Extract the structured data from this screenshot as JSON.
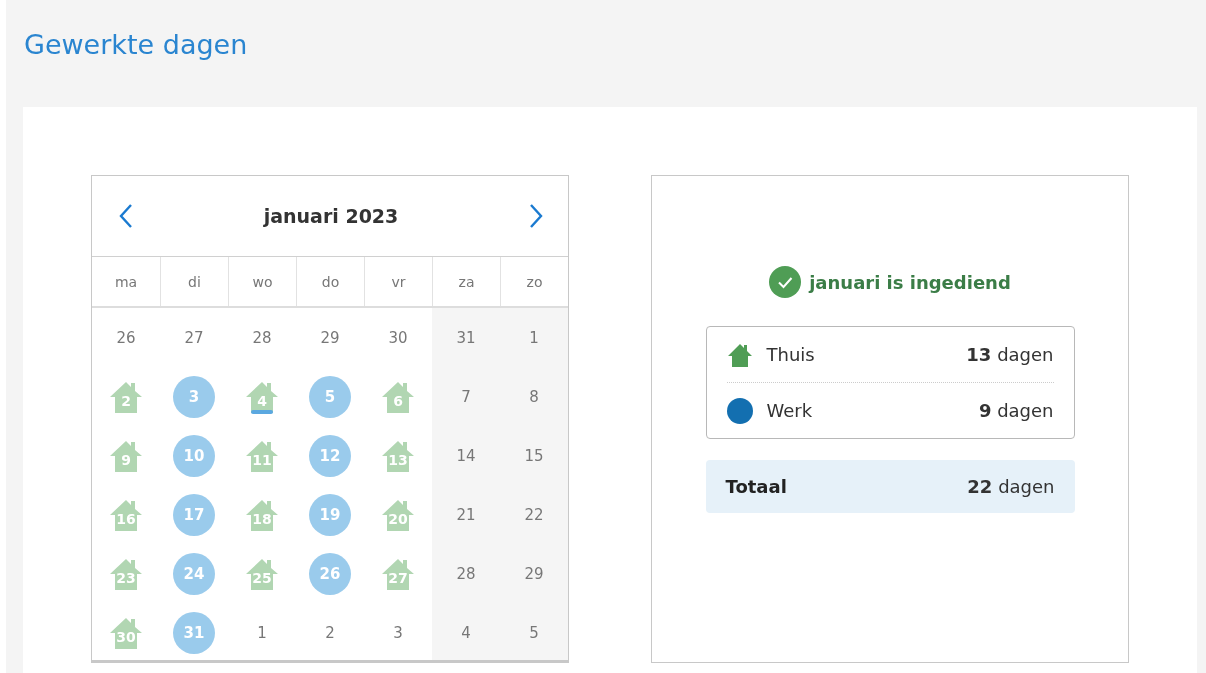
{
  "title": "Gewerkte dagen",
  "calendar": {
    "month": "januari 2023",
    "weekdays": [
      {
        "label": "ma",
        "weekend": false
      },
      {
        "label": "di",
        "weekend": false
      },
      {
        "label": "wo",
        "weekend": false
      },
      {
        "label": "do",
        "weekend": false
      },
      {
        "label": "vr",
        "weekend": false
      },
      {
        "label": "za",
        "weekend": true
      },
      {
        "label": "zo",
        "weekend": true
      }
    ],
    "days": [
      {
        "label": "26",
        "kind": "plain",
        "today": false
      },
      {
        "label": "27",
        "kind": "plain",
        "today": false
      },
      {
        "label": "28",
        "kind": "plain",
        "today": false
      },
      {
        "label": "29",
        "kind": "plain",
        "today": false
      },
      {
        "label": "30",
        "kind": "plain",
        "today": false
      },
      {
        "label": "31",
        "kind": "plain",
        "today": false
      },
      {
        "label": "1",
        "kind": "plain",
        "today": false
      },
      {
        "label": "2",
        "kind": "home",
        "today": false
      },
      {
        "label": "3",
        "kind": "work",
        "today": false
      },
      {
        "label": "4",
        "kind": "home",
        "today": true
      },
      {
        "label": "5",
        "kind": "work",
        "today": false
      },
      {
        "label": "6",
        "kind": "home",
        "today": false
      },
      {
        "label": "7",
        "kind": "plain",
        "today": false
      },
      {
        "label": "8",
        "kind": "plain",
        "today": false
      },
      {
        "label": "9",
        "kind": "home",
        "today": false
      },
      {
        "label": "10",
        "kind": "work",
        "today": false
      },
      {
        "label": "11",
        "kind": "home",
        "today": false
      },
      {
        "label": "12",
        "kind": "work",
        "today": false
      },
      {
        "label": "13",
        "kind": "home",
        "today": false
      },
      {
        "label": "14",
        "kind": "plain",
        "today": false
      },
      {
        "label": "15",
        "kind": "plain",
        "today": false
      },
      {
        "label": "16",
        "kind": "home",
        "today": false
      },
      {
        "label": "17",
        "kind": "work",
        "today": false
      },
      {
        "label": "18",
        "kind": "home",
        "today": false
      },
      {
        "label": "19",
        "kind": "work",
        "today": false
      },
      {
        "label": "20",
        "kind": "home",
        "today": false
      },
      {
        "label": "21",
        "kind": "plain",
        "today": false
      },
      {
        "label": "22",
        "kind": "plain",
        "today": false
      },
      {
        "label": "23",
        "kind": "home",
        "today": false
      },
      {
        "label": "24",
        "kind": "work",
        "today": false
      },
      {
        "label": "25",
        "kind": "home",
        "today": false
      },
      {
        "label": "26",
        "kind": "work",
        "today": false
      },
      {
        "label": "27",
        "kind": "home",
        "today": false
      },
      {
        "label": "28",
        "kind": "plain",
        "today": false
      },
      {
        "label": "29",
        "kind": "plain",
        "today": false
      },
      {
        "label": "30",
        "kind": "home",
        "today": false
      },
      {
        "label": "31",
        "kind": "work",
        "today": false
      },
      {
        "label": "1",
        "kind": "plain",
        "today": false
      },
      {
        "label": "2",
        "kind": "plain",
        "today": false
      },
      {
        "label": "3",
        "kind": "plain",
        "today": false
      },
      {
        "label": "4",
        "kind": "plain",
        "today": false
      },
      {
        "label": "5",
        "kind": "plain",
        "today": false
      }
    ]
  },
  "summary": {
    "status": "januari is ingediend",
    "items": [
      {
        "kind": "home",
        "label": "Thuis",
        "count": "**13** dagen"
      },
      {
        "kind": "work",
        "label": "Werk",
        "count": "**9** dagen"
      }
    ],
    "total": {
      "label": "Totaal",
      "count": "**22** dagen"
    }
  }
}
